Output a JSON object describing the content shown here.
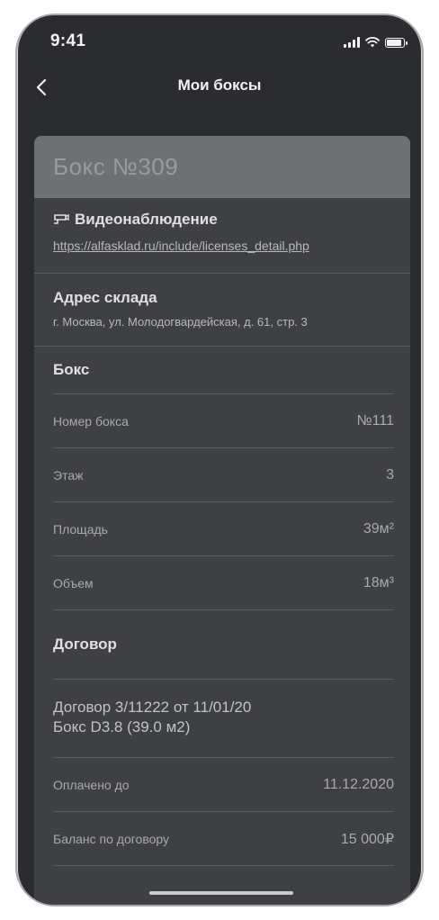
{
  "status_bar": {
    "time": "9:41"
  },
  "nav": {
    "title": "Мои боксы",
    "back_icon": "chevron-left-icon"
  },
  "card": {
    "title": "Бокс №309",
    "camera": {
      "icon": "cctv-camera-icon",
      "title": "Видеонаблюдение",
      "link": "https://alfasklad.ru/include/licenses_detail.php"
    },
    "address": {
      "title": "Адрес склада",
      "text": "г. Москва, ул. Молодогвардейская, д. 61, стр. 3"
    },
    "box": {
      "title": "Бокс",
      "rows": [
        {
          "label": "Номер бокса",
          "value": "№111"
        },
        {
          "label": "Этаж",
          "value": "3"
        },
        {
          "label": "Площадь",
          "value": "39м²"
        },
        {
          "label": "Объем",
          "value": "18м³"
        }
      ]
    },
    "contract": {
      "title": "Договор",
      "line1": "Договор 3/11222 от 11/01/20",
      "line2": "Бокс D3.8 (39.0 м2)",
      "rows": [
        {
          "label": "Оплачено до",
          "value": "11.12.2020"
        },
        {
          "label": "Баланс по договору",
          "value": "15 000₽"
        }
      ]
    }
  },
  "colors": {
    "background": "#2b2c2f",
    "card": "#3f4044",
    "card_header": "#6e7074"
  }
}
